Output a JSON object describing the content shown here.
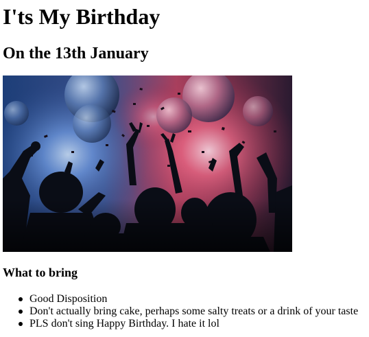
{
  "page": {
    "title": "I'ts My Birthday",
    "subtitle": "On the 13th January"
  },
  "party_image": {
    "colors": {
      "blue_glow": "#5a8ee0",
      "pink_glow": "#e8506a",
      "background": "#0c1a30",
      "silhouette": "#0a0d16"
    }
  },
  "bring_section": {
    "heading": "What to bring",
    "items": [
      "Good Disposition",
      "Don't actually bring cake, perhaps some salty treats or a drink of your taste",
      "PLS don't sing Happy Birthday. I hate it lol"
    ]
  }
}
